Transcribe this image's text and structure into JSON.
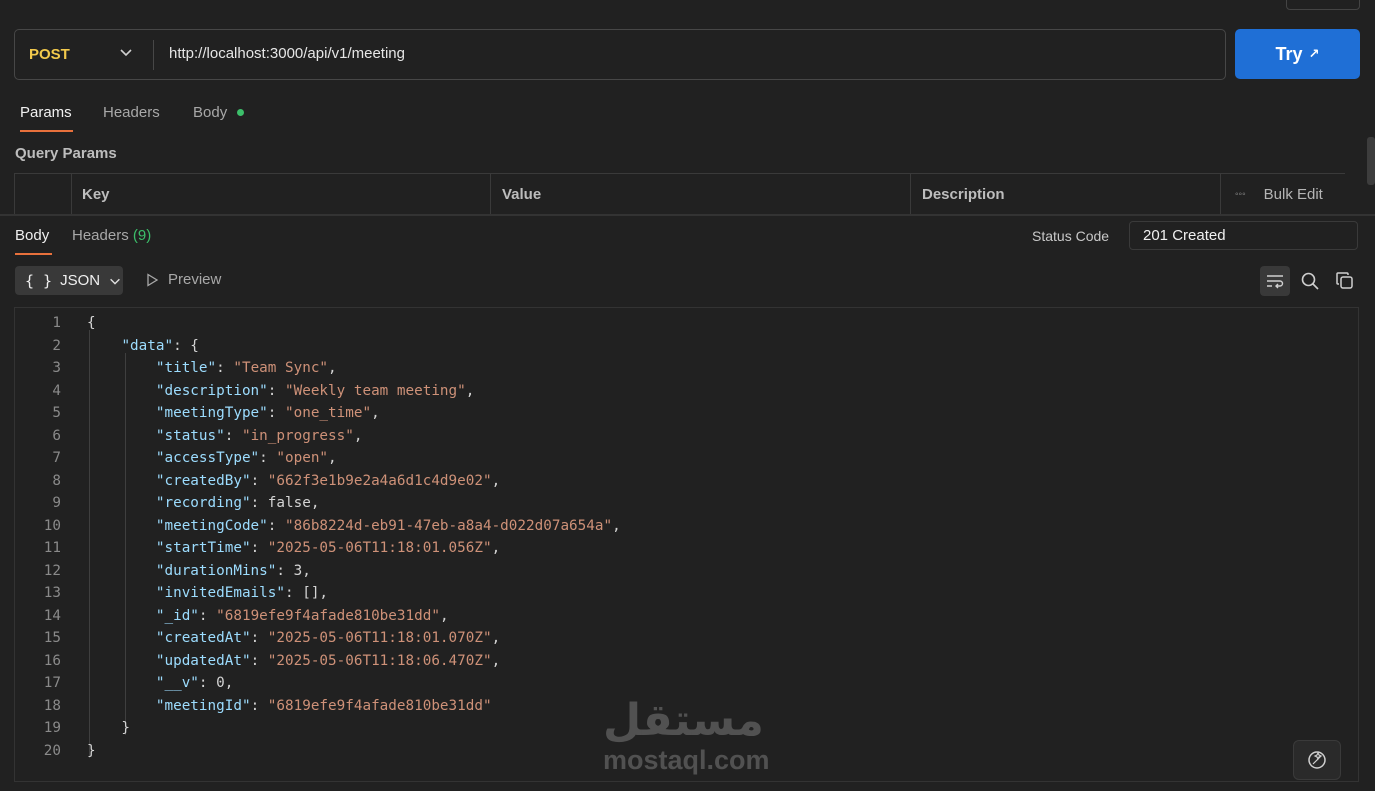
{
  "request": {
    "method": "POST",
    "url": "http://localhost:3000/api/v1/meeting",
    "try_label": "Try",
    "try_arrow": "↗",
    "tabs": [
      {
        "label": "Params"
      },
      {
        "label": "Headers"
      },
      {
        "label": "Body"
      }
    ],
    "query_params_label": "Query Params",
    "columns": [
      "Key",
      "Value",
      "Description"
    ],
    "bulk_edit": "Bulk Edit",
    "more_glyph": "◦◦◦"
  },
  "response": {
    "tabs": [
      {
        "label": "Body"
      },
      {
        "label": "Headers",
        "count": "(9)"
      }
    ],
    "status_label": "Status Code",
    "status_value": "201 Created",
    "format": "JSON",
    "braces": "{ }",
    "preview": "Preview",
    "lines": [
      {
        "n": "1",
        "t": "{"
      },
      {
        "n": "2",
        "t": "    \"data\": {"
      },
      {
        "n": "3",
        "t": "        \"title\": \"Team Sync\","
      },
      {
        "n": "4",
        "t": "        \"description\": \"Weekly team meeting\","
      },
      {
        "n": "5",
        "t": "        \"meetingType\": \"one_time\","
      },
      {
        "n": "6",
        "t": "        \"status\": \"in_progress\","
      },
      {
        "n": "7",
        "t": "        \"accessType\": \"open\","
      },
      {
        "n": "8",
        "t": "        \"createdBy\": \"662f3e1b9e2a4a6d1c4d9e02\","
      },
      {
        "n": "9",
        "t": "        \"recording\": false,"
      },
      {
        "n": "10",
        "t": "        \"meetingCode\": \"86b8224d-eb91-47eb-a8a4-d022d07a654a\","
      },
      {
        "n": "11",
        "t": "        \"startTime\": \"2025-05-06T11:18:01.056Z\","
      },
      {
        "n": "12",
        "t": "        \"durationMins\": 3,"
      },
      {
        "n": "13",
        "t": "        \"invitedEmails\": [],"
      },
      {
        "n": "14",
        "t": "        \"_id\": \"6819efe9f4afade810be31dd\","
      },
      {
        "n": "15",
        "t": "        \"createdAt\": \"2025-05-06T11:18:01.070Z\","
      },
      {
        "n": "16",
        "t": "        \"updatedAt\": \"2025-05-06T11:18:06.470Z\","
      },
      {
        "n": "17",
        "t": "        \"__v\": 0,"
      },
      {
        "n": "18",
        "t": "        \"meetingId\": \"6819efe9f4afade810be31dd\""
      },
      {
        "n": "19",
        "t": "    }"
      },
      {
        "n": "20",
        "t": "}"
      }
    ]
  },
  "watermark": {
    "arabic": "مستقل",
    "latin": "mostaql.com"
  },
  "colors": {
    "accent": "#e8713c",
    "try_button": "#1f6fd6",
    "method": "#f2c94c",
    "status_ok": "#3cbf6a"
  }
}
